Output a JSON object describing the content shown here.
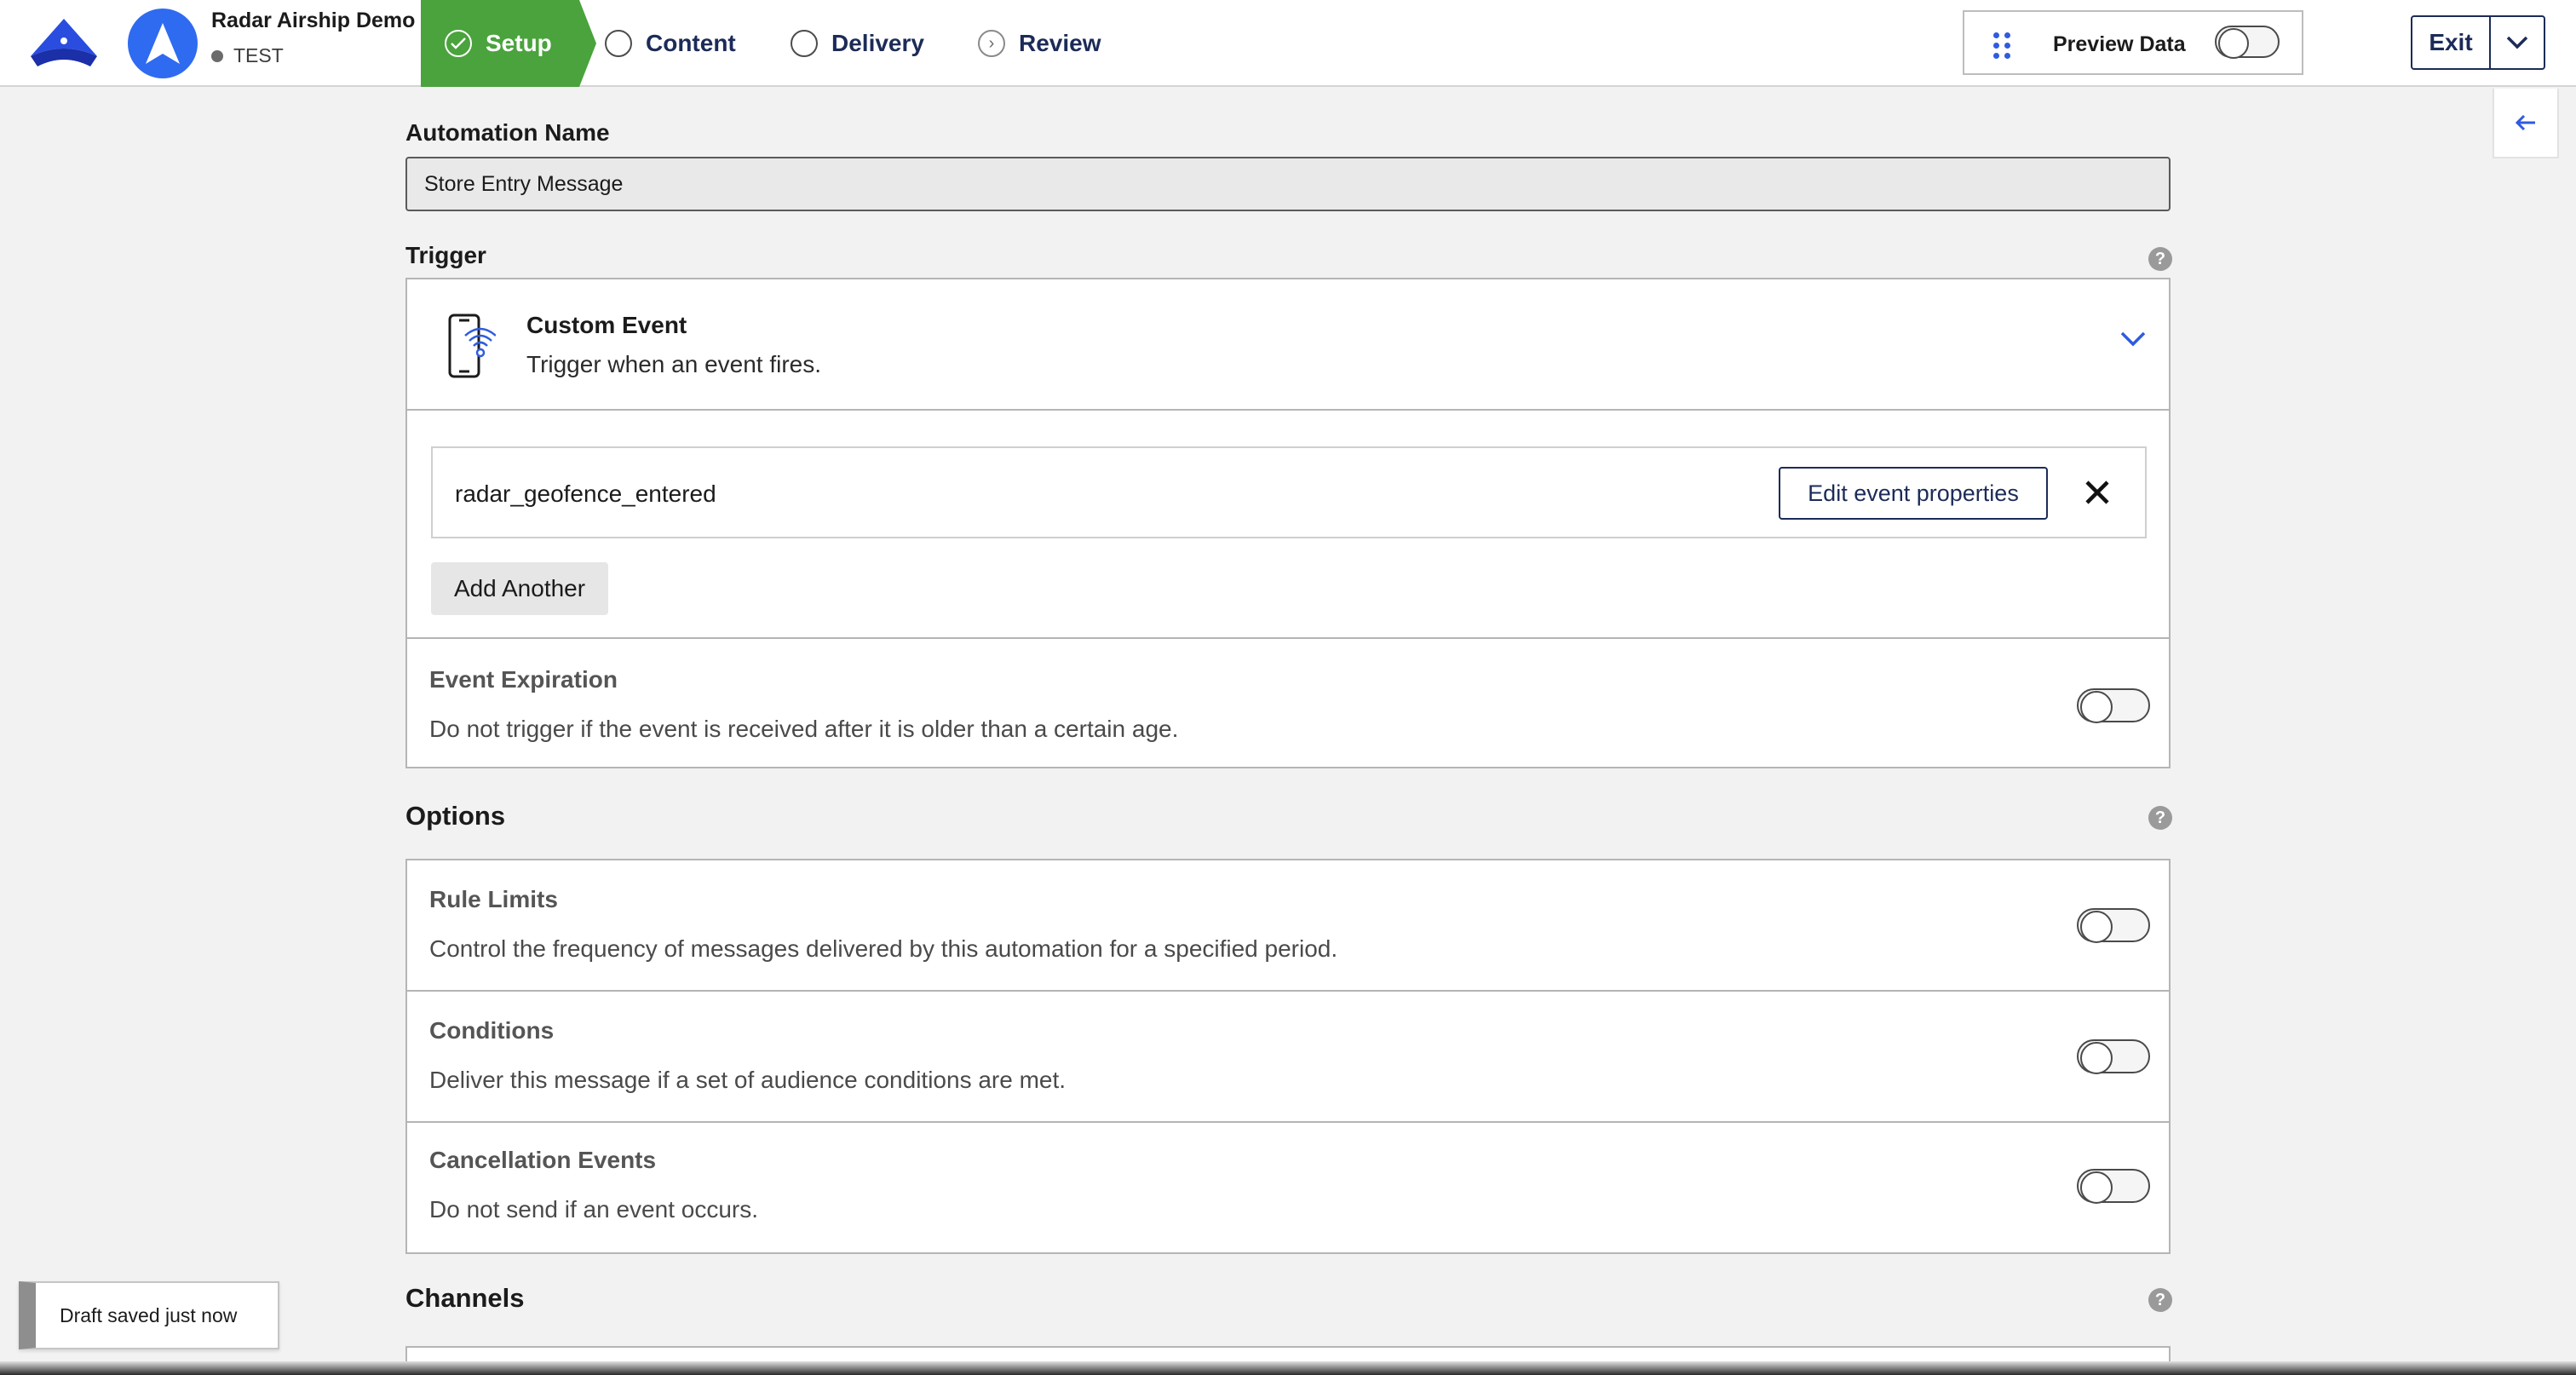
{
  "header": {
    "project_name": "Radar Airship Demo",
    "environment": "TEST",
    "steps": [
      {
        "label": "Setup",
        "state": "active"
      },
      {
        "label": "Content",
        "state": "pending"
      },
      {
        "label": "Delivery",
        "state": "pending"
      },
      {
        "label": "Review",
        "state": "next"
      }
    ],
    "preview_label": "Preview Data",
    "preview_enabled": false,
    "exit_label": "Exit"
  },
  "form": {
    "automation_name_label": "Automation Name",
    "automation_name_value": "Store Entry Message",
    "trigger_label": "Trigger",
    "trigger": {
      "title": "Custom Event",
      "description": "Trigger when an event fires.",
      "event_name": "radar_geofence_entered",
      "edit_props_label": "Edit event properties",
      "add_another_label": "Add Another"
    },
    "event_expiration": {
      "title": "Event Expiration",
      "description": "Do not trigger if the event is received after it is older than a certain age.",
      "enabled": false
    },
    "options_label": "Options",
    "options": [
      {
        "title": "Rule Limits",
        "description": "Control the frequency of messages delivered by this automation for a specified period.",
        "enabled": false
      },
      {
        "title": "Conditions",
        "description": "Deliver this message if a set of audience conditions are met.",
        "enabled": false
      },
      {
        "title": "Cancellation Events",
        "description": "Do not send if an event occurs.",
        "enabled": false
      }
    ],
    "channels_label": "Channels"
  },
  "status": {
    "draft_text": "Draft saved just now"
  },
  "colors": {
    "accent_green": "#4aa33c",
    "navy": "#1c2b58",
    "brand_blue": "#2f6bf0"
  }
}
